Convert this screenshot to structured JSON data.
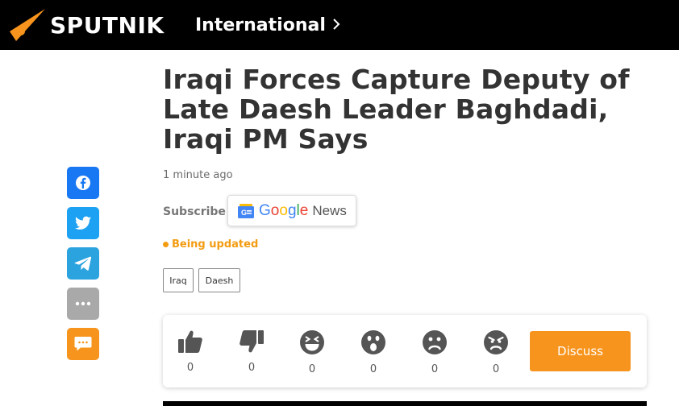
{
  "header": {
    "logo_text": "SPUTNIK",
    "edition": "International"
  },
  "article": {
    "title": "Iraqi Forces Capture Deputy of Late Daesh Leader Baghdadi, Iraqi PM Says",
    "time": "1 minute ago",
    "subscribe_label": "Subscribe",
    "google_news": {
      "google": "Google",
      "news": "News"
    },
    "status": "Being updated",
    "tags": [
      "Iraq",
      "Daesh"
    ]
  },
  "share": {
    "items": [
      {
        "icon": "facebook-icon",
        "color": "#1877f2"
      },
      {
        "icon": "twitter-icon",
        "color": "#1da1f2"
      },
      {
        "icon": "telegram-icon",
        "color": "#2aa3df"
      },
      {
        "icon": "more-icon",
        "color": "#a9a9a9"
      },
      {
        "icon": "comment-icon",
        "color": "#f7941d"
      }
    ]
  },
  "reactions": {
    "items": [
      {
        "icon": "like-icon",
        "count": "0"
      },
      {
        "icon": "dislike-icon",
        "count": "0"
      },
      {
        "icon": "laugh-icon",
        "count": "0"
      },
      {
        "icon": "surprise-icon",
        "count": "0"
      },
      {
        "icon": "sad-icon",
        "count": "0"
      },
      {
        "icon": "angry-icon",
        "count": "0"
      }
    ],
    "discuss_label": "Discuss"
  },
  "colors": {
    "accent": "#f7941d",
    "header_bg": "#000000",
    "reaction_icon": "#555555"
  }
}
